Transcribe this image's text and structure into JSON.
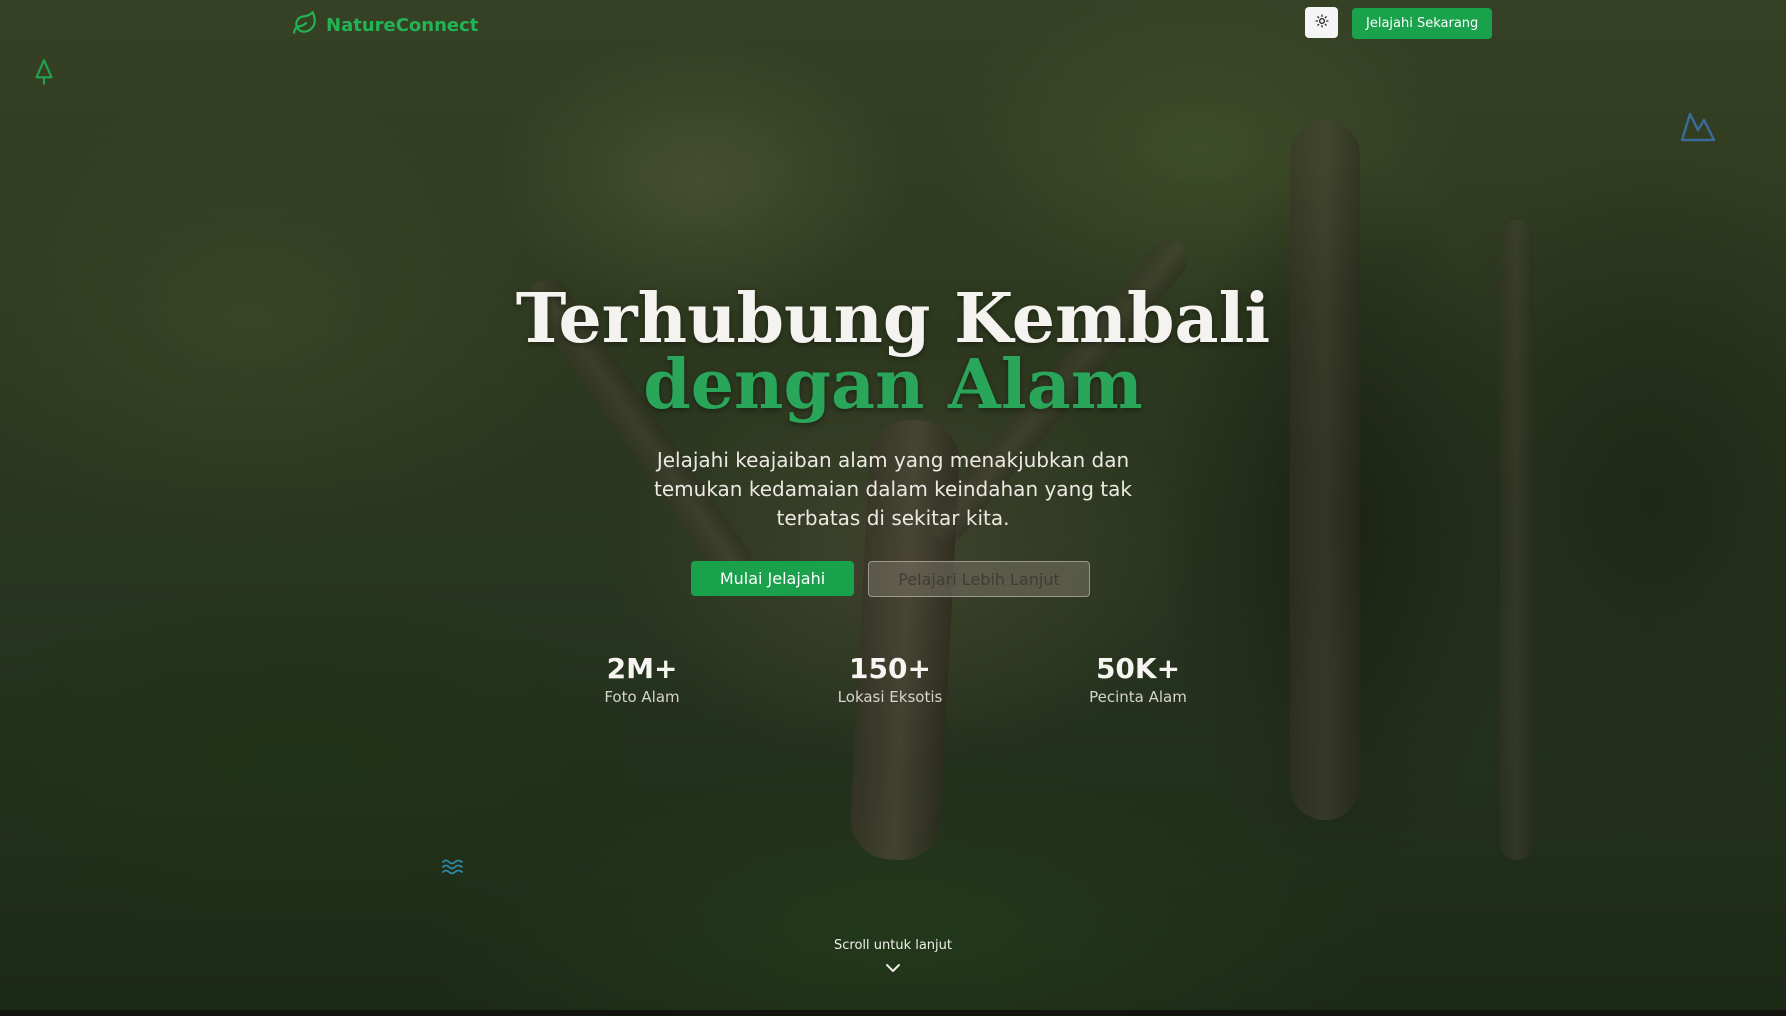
{
  "brand": {
    "name": "NatureConnect",
    "logo_icon": "leaf-icon",
    "accent": "#22b454"
  },
  "nav": {
    "theme_toggle_icon": "sun-icon",
    "cta_label": "Jelajahi Sekarang"
  },
  "hero": {
    "title_line1": "Terhubung Kembali",
    "title_line2": "dengan Alam",
    "subtitle": "Jelajahi keajaiban alam yang menakjubkan dan temukan kedamaian dalam keindahan yang tak terbatas di sekitar kita.",
    "primary_button": "Mulai Jelajahi",
    "secondary_button": "Pelajari Lebih Lanjut"
  },
  "stats": [
    {
      "value": "2M+",
      "label": "Foto Alam"
    },
    {
      "value": "150+",
      "label": "Lokasi Eksotis"
    },
    {
      "value": "50K+",
      "label": "Pecinta Alam"
    }
  ],
  "floating_icons": [
    "tree-icon",
    "mountain-icon",
    "waves-icon"
  ],
  "scroll": {
    "text": "Scroll untuk lanjut",
    "icon": "chevron-down-icon"
  },
  "colors": {
    "primary": "#1aa14b",
    "title_accent": "#2aa65a"
  }
}
